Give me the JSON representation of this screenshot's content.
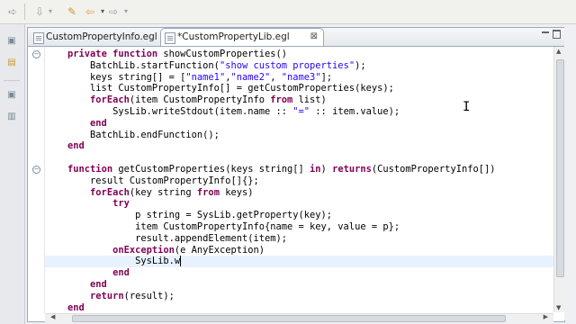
{
  "toolbar": {
    "icons": [
      "run-icon",
      "dropdown-icon",
      "debug-icon",
      "dropdown-icon",
      "marker-icon",
      "back-icon",
      "dropdown-icon",
      "forward-icon",
      "dropdown-icon"
    ]
  },
  "editor": {
    "tabs": [
      {
        "label": "CustomPropertyInfo.egl",
        "active": false
      },
      {
        "label": "*CustomPropertyLib.egl",
        "active": true,
        "close": "⊠"
      }
    ],
    "lines": [
      {
        "indent": "    ",
        "segments": [
          [
            "kw",
            "private function"
          ],
          [
            "",
            " showCustomProperties()"
          ]
        ]
      },
      {
        "indent": "        ",
        "segments": [
          [
            "",
            "BatchLib.startFunction("
          ],
          [
            "str",
            "\"show custom properties\""
          ],
          [
            "",
            ");"
          ]
        ]
      },
      {
        "indent": "        ",
        "segments": [
          [
            "",
            "keys string[] = ["
          ],
          [
            "str",
            "\"name1\""
          ],
          [
            "",
            ","
          ],
          [
            "str",
            "\"name2\""
          ],
          [
            "",
            ", "
          ],
          [
            "str",
            "\"name3\""
          ],
          [
            "",
            "];"
          ]
        ]
      },
      {
        "indent": "        ",
        "segments": [
          [
            "",
            "list CustomPropertyInfo[] = getCustomProperties(keys);"
          ]
        ]
      },
      {
        "indent": "        ",
        "segments": [
          [
            "kw",
            "forEach"
          ],
          [
            "",
            "(item CustomPropertyInfo "
          ],
          [
            "kw",
            "from"
          ],
          [
            "",
            " list)"
          ]
        ]
      },
      {
        "indent": "            ",
        "segments": [
          [
            "",
            "SysLib.writeStdout(item.name :: "
          ],
          [
            "str",
            "\"=\""
          ],
          [
            "",
            " :: item.value);"
          ]
        ]
      },
      {
        "indent": "        ",
        "segments": [
          [
            "kw",
            "end"
          ]
        ]
      },
      {
        "indent": "        ",
        "segments": [
          [
            "",
            "BatchLib.endFunction();"
          ]
        ]
      },
      {
        "indent": "    ",
        "segments": [
          [
            "kw",
            "end"
          ]
        ]
      },
      {
        "indent": "",
        "segments": [
          [
            "",
            ""
          ]
        ]
      },
      {
        "indent": "    ",
        "segments": [
          [
            "kw",
            "function"
          ],
          [
            "",
            " getCustomProperties(keys string[] "
          ],
          [
            "kw",
            "in"
          ],
          [
            "",
            ") "
          ],
          [
            "kw",
            "returns"
          ],
          [
            "",
            "(CustomPropertyInfo[])"
          ]
        ]
      },
      {
        "indent": "        ",
        "segments": [
          [
            "",
            "result CustomPropertyInfo[]{};"
          ]
        ]
      },
      {
        "indent": "        ",
        "segments": [
          [
            "kw",
            "forEach"
          ],
          [
            "",
            "(key string "
          ],
          [
            "kw",
            "from"
          ],
          [
            "",
            " keys)"
          ]
        ]
      },
      {
        "indent": "            ",
        "segments": [
          [
            "kw",
            "try"
          ]
        ]
      },
      {
        "indent": "                ",
        "segments": [
          [
            "",
            "p string = SysLib.getProperty(key);"
          ]
        ]
      },
      {
        "indent": "                ",
        "segments": [
          [
            "",
            "item CustomPropertyInfo{name = key, value = p};"
          ]
        ]
      },
      {
        "indent": "                ",
        "segments": [
          [
            "",
            "result.appendElement(item);"
          ]
        ]
      },
      {
        "indent": "            ",
        "segments": [
          [
            "kw",
            "onException"
          ],
          [
            "",
            "(e AnyException)"
          ]
        ]
      },
      {
        "indent": "                ",
        "segments": [
          [
            "",
            "SysLib.w"
          ]
        ]
      },
      {
        "indent": "            ",
        "segments": [
          [
            "kw",
            "end"
          ]
        ]
      },
      {
        "indent": "        ",
        "segments": [
          [
            "kw",
            "end"
          ]
        ]
      },
      {
        "indent": "        ",
        "segments": [
          [
            "kw",
            "return"
          ],
          [
            "",
            "(result);"
          ]
        ]
      },
      {
        "indent": "    ",
        "segments": [
          [
            "kw",
            "end"
          ]
        ]
      }
    ],
    "current_line_index": 18
  }
}
